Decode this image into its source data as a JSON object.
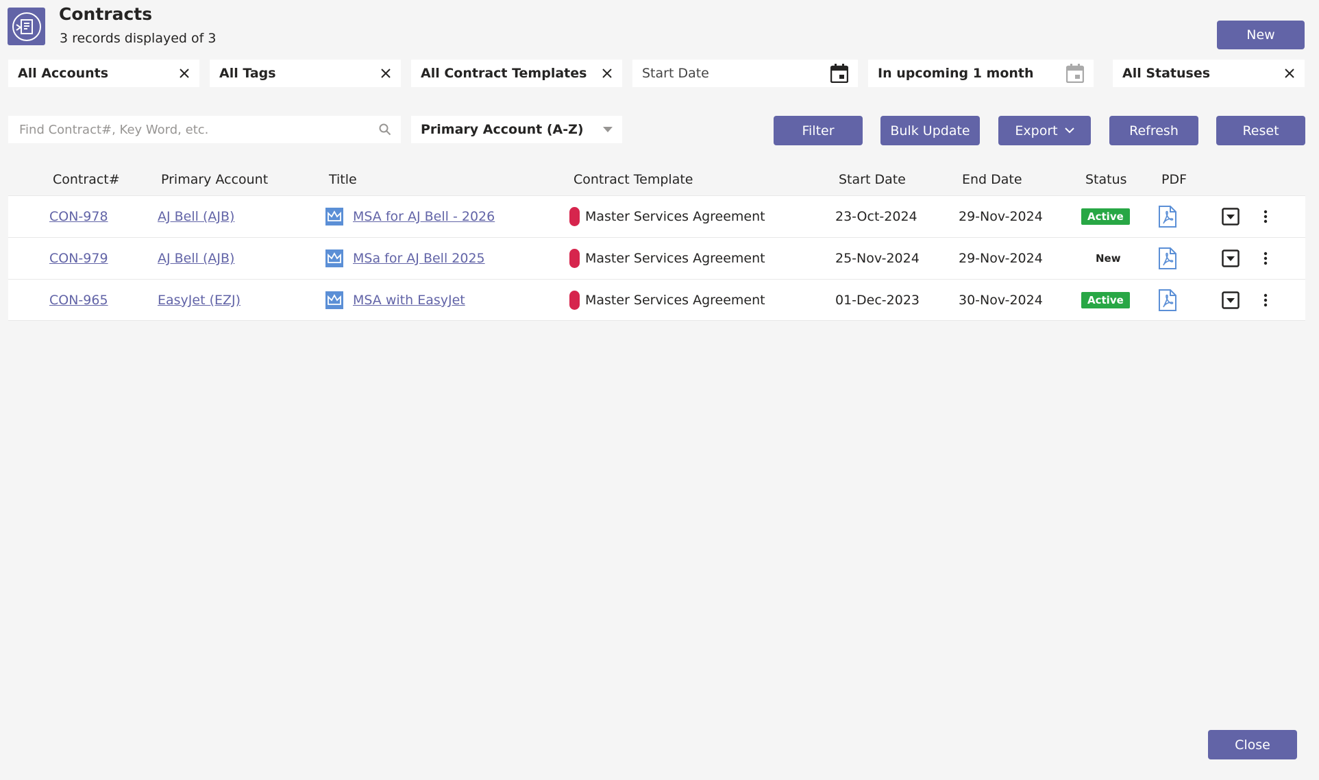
{
  "header": {
    "title": "Contracts",
    "record_count": "3 records displayed of 3",
    "new_label": "New",
    "logo_icon": "contract-icon"
  },
  "filters": {
    "accounts": "All Accounts",
    "tags": "All Tags",
    "templates": "All Contract Templates",
    "start_date_placeholder": "Start Date",
    "end_date": "In upcoming 1 month",
    "statuses": "All Statuses"
  },
  "search": {
    "placeholder": "Find Contract#, Key Word, etc.",
    "value": ""
  },
  "sort": {
    "selected": "Primary Account (A-Z)"
  },
  "toolbar": {
    "filter": "Filter",
    "bulk_update": "Bulk Update",
    "export": "Export",
    "refresh": "Refresh",
    "reset": "Reset"
  },
  "table": {
    "columns": [
      "Contract#",
      "Primary Account",
      "Title",
      "Contract Template",
      "Start Date",
      "End Date",
      "Status",
      "PDF"
    ],
    "rows": [
      {
        "contract": "CON-978",
        "account": "AJ Bell (AJB)",
        "title": "MSA for AJ Bell - 2026",
        "template": "Master Services Agreement",
        "start": "23-Oct-2024",
        "end": "29-Nov-2024",
        "status": "Active"
      },
      {
        "contract": "CON-979",
        "account": "AJ Bell (AJB)",
        "title": "MSa for AJ Bell 2025",
        "template": "Master Services Agreement",
        "start": "25-Nov-2024",
        "end": "29-Nov-2024",
        "status": "New"
      },
      {
        "contract": "CON-965",
        "account": "EasyJet (EZJ)",
        "title": "MSA with EasyJet",
        "template": "Master Services Agreement",
        "start": "01-Dec-2023",
        "end": "30-Nov-2024",
        "status": "Active"
      }
    ]
  },
  "footer": {
    "close_label": "Close"
  },
  "colors": {
    "accent": "#6264a7",
    "active_badge": "#28a745",
    "template_marker": "#d6254d"
  }
}
